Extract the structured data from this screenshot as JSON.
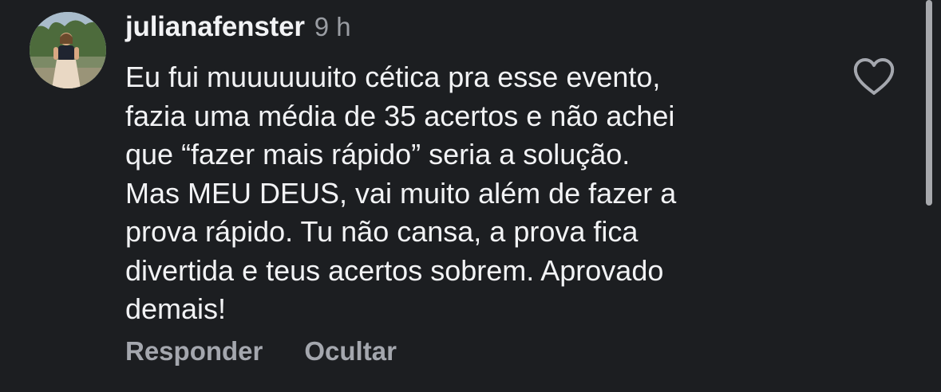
{
  "comment": {
    "username": "julianafenster",
    "time": "9 h",
    "text_lines": [
      "Eu fui muuuuuuito cética pra esse evento,",
      "fazia uma média de 35 acertos e não achei",
      "que “fazer mais rápido” seria a solução.",
      "Mas MEU DEUS, vai muito além de fazer a",
      "prova rápido. Tu não cansa, a prova fica",
      "divertida e teus acertos sobrem. Aprovado",
      "demais!"
    ],
    "actions": {
      "reply": "Responder",
      "hide": "Ocultar"
    }
  },
  "icons": {
    "like": "heart-outline-icon"
  },
  "colors": {
    "background": "#1c1e21",
    "text": "#f2f3f5",
    "muted": "#9a9da3",
    "action": "#a4a7ae",
    "scrollbar": "#a7a9ad"
  }
}
